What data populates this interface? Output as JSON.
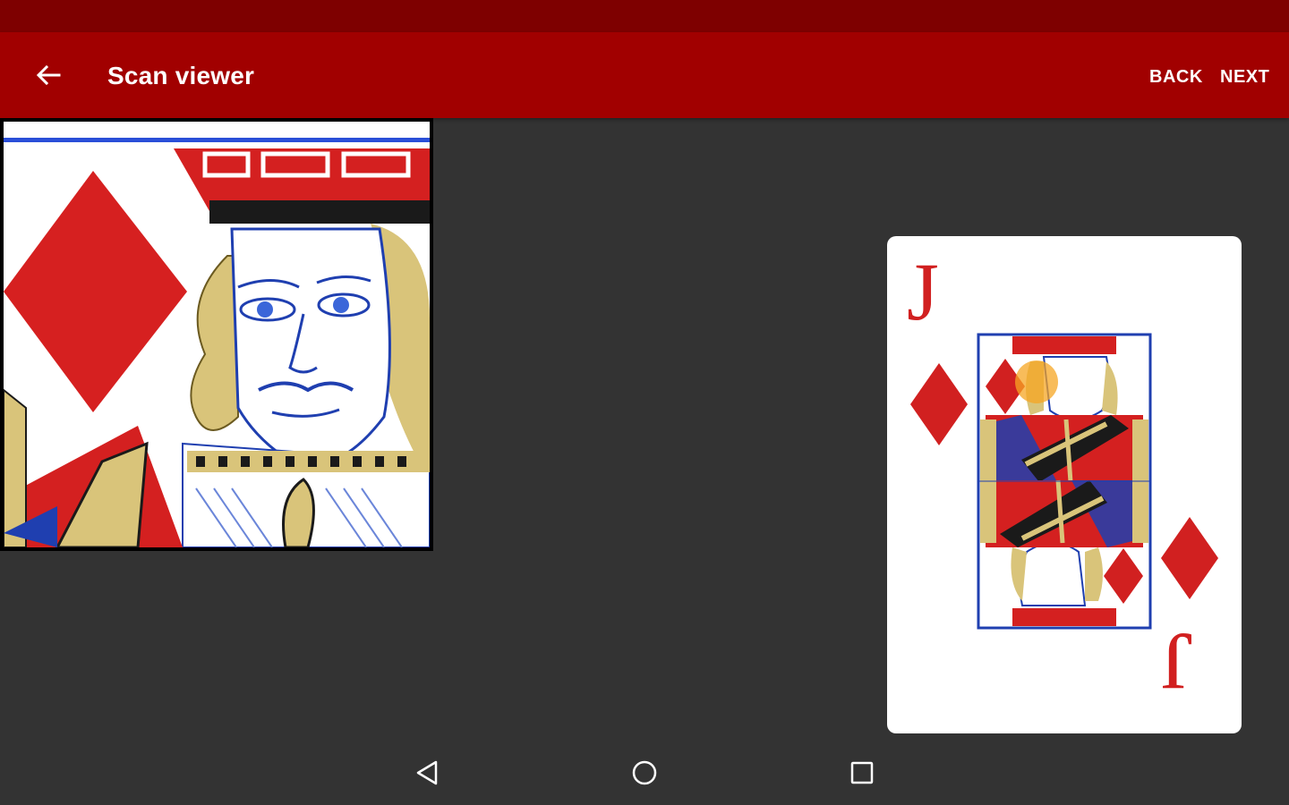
{
  "app_bar": {
    "title": "Scan viewer",
    "back_icon": "arrow-left-icon",
    "actions": {
      "back_label": "BACK",
      "next_label": "NEXT"
    }
  },
  "card": {
    "rank": "J",
    "suit": "diamonds",
    "suit_icon": "diamond-icon"
  },
  "system_nav": {
    "back_icon": "triangle-back-icon",
    "home_icon": "circle-home-icon",
    "recents_icon": "square-recents-icon"
  },
  "colors": {
    "status_bar": "#7e0000",
    "app_bar": "#a10000",
    "background": "#333333",
    "suit_red": "#d12020",
    "focus_marker": "#f5a623"
  }
}
